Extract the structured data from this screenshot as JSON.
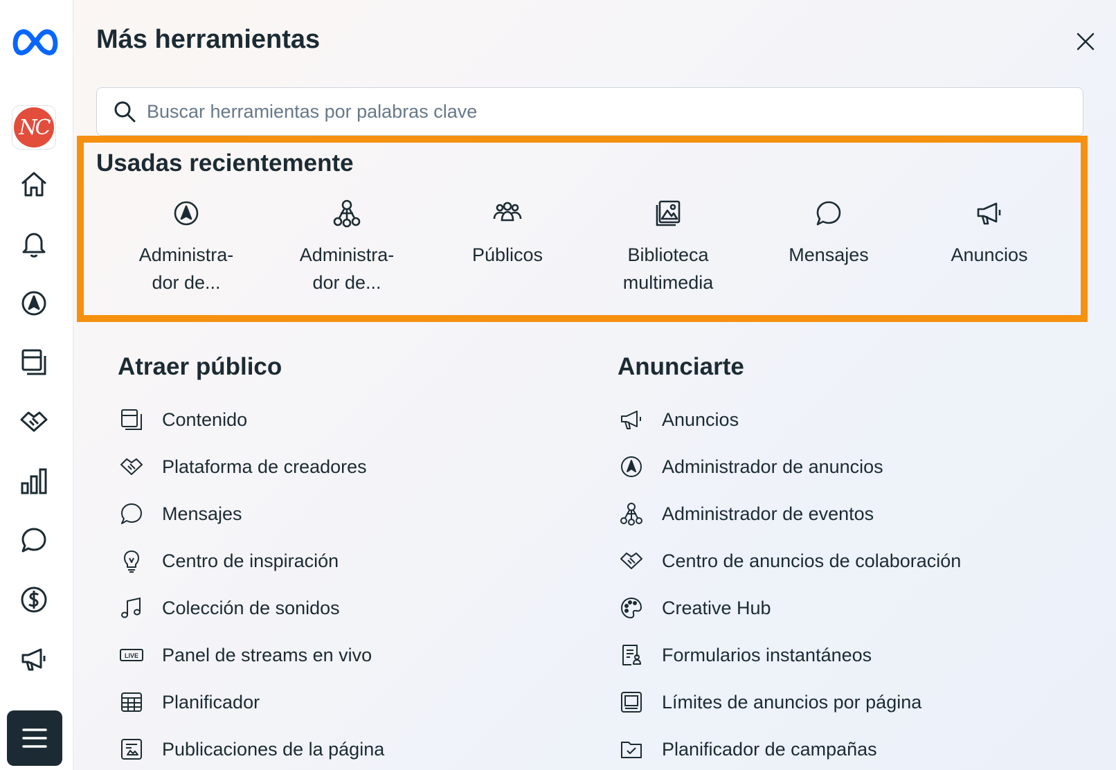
{
  "rail": {
    "brand_color": "#0866ff",
    "avatar_initials": "NC",
    "items": [
      {
        "icon": "home-icon"
      },
      {
        "icon": "bell-icon"
      },
      {
        "icon": "ads-manager-icon"
      },
      {
        "icon": "content-icon"
      },
      {
        "icon": "handshake-icon"
      },
      {
        "icon": "bar-chart-icon"
      },
      {
        "icon": "message-icon"
      },
      {
        "icon": "dollar-icon"
      },
      {
        "icon": "megaphone-icon"
      }
    ],
    "menu_icon": "menu-icon"
  },
  "panel": {
    "title": "Más herramientas",
    "search_placeholder": "Buscar herramientas por palabras clave",
    "highlight_color": "#f6900f"
  },
  "recent": {
    "title": "Usadas recientemente",
    "items": [
      {
        "icon": "ads-manager-icon",
        "line1": "Administra-",
        "line2": "dor de..."
      },
      {
        "icon": "events-icon",
        "line1": "Administra-",
        "line2": "dor de..."
      },
      {
        "icon": "audiences-icon",
        "line1": "Públicos",
        "line2": ""
      },
      {
        "icon": "media-library-icon",
        "line1": "Biblioteca",
        "line2": "multimedia"
      },
      {
        "icon": "message-icon",
        "line1": "Mensajes",
        "line2": ""
      },
      {
        "icon": "megaphone-icon",
        "line1": "Anuncios",
        "line2": ""
      }
    ]
  },
  "attract": {
    "title": "Atraer público",
    "items": [
      {
        "icon": "content-icon",
        "label": "Contenido"
      },
      {
        "icon": "handshake-icon",
        "label": "Plataforma de creadores"
      },
      {
        "icon": "message-icon",
        "label": "Mensajes"
      },
      {
        "icon": "lightbulb-icon",
        "label": "Centro de inspiración"
      },
      {
        "icon": "music-note-icon",
        "label": "Colección de sonidos"
      },
      {
        "icon": "live-icon",
        "label": "Panel de streams en vivo",
        "badge": "LIVE"
      },
      {
        "icon": "calendar-grid-icon",
        "label": "Planificador"
      },
      {
        "icon": "page-posts-icon",
        "label": "Publicaciones de la página"
      }
    ]
  },
  "advertise": {
    "title": "Anunciarte",
    "items": [
      {
        "icon": "megaphone-icon",
        "label": "Anuncios"
      },
      {
        "icon": "ads-manager-icon",
        "label": "Administrador de anuncios"
      },
      {
        "icon": "events-icon",
        "label": "Administrador de eventos"
      },
      {
        "icon": "handshake-icon",
        "label": "Centro de anuncios de colaboración"
      },
      {
        "icon": "palette-icon",
        "label": "Creative Hub"
      },
      {
        "icon": "form-icon",
        "label": "Formularios instantáneos"
      },
      {
        "icon": "page-limit-icon",
        "label": "Límites de anuncios por página"
      },
      {
        "icon": "folder-check-icon",
        "label": "Planificador de campañas"
      }
    ]
  }
}
